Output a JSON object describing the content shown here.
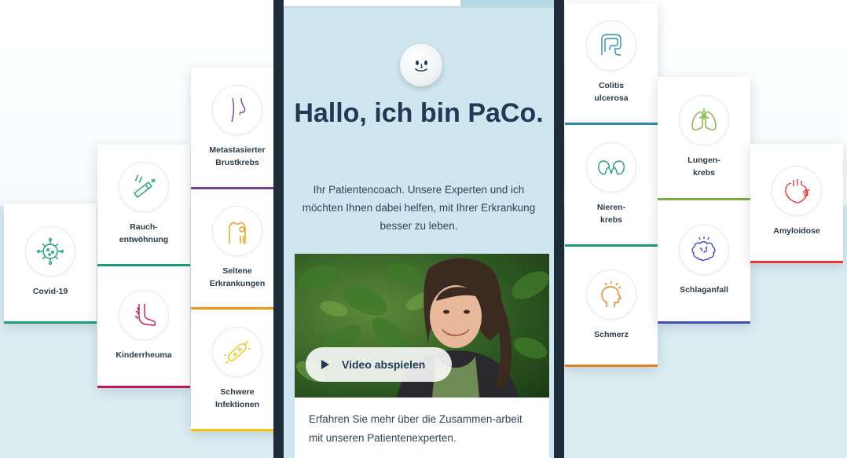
{
  "assistant": {
    "greeting": "Hallo, ich bin PaCo.",
    "intro": "Ihr Patientencoach. Unsere Experten und ich möchten Ihnen dabei helfen, mit Ihrer Erkrankung besser zu leben.",
    "video_button": "Video abspielen",
    "more_text": "Erfahren Sie mehr über die Zusammen-arbeit mit unseren Patientenexperten."
  },
  "cards": [
    {
      "label": "Covid-19",
      "icon": "virus-icon",
      "color": "#1f9e7a"
    },
    {
      "label": "Rauch-\nentwöhnung",
      "icon": "cigarette-icon",
      "color": "#1f9e7a"
    },
    {
      "label": "Kinderrheuma",
      "icon": "foot-icon",
      "color": "#c2185b"
    },
    {
      "label": "Metastasierter\nBrustkrebs",
      "icon": "breast-icon",
      "color": "#7b3fa0"
    },
    {
      "label": "Seltene\nErkrankungen",
      "icon": "body-icon",
      "color": "#f39c12"
    },
    {
      "label": "Schwere\nInfektionen",
      "icon": "bacteria-icon",
      "color": "#f1c40f"
    },
    {
      "label": "Colitis\nulcerosa",
      "icon": "intestine-icon",
      "color": "#2f8fb5"
    },
    {
      "label": "Nieren-\nkrebs",
      "icon": "kidney-icon",
      "color": "#1f9e7a"
    },
    {
      "label": "Schmerz",
      "icon": "head-pain-icon",
      "color": "#e67e22"
    },
    {
      "label": "Lungen-\nkrebs",
      "icon": "lungs-icon",
      "color": "#7cb342"
    },
    {
      "label": "Schlaganfall",
      "icon": "brain-icon",
      "color": "#3f51b5"
    },
    {
      "label": "Amyloidose",
      "icon": "heart-icon",
      "color": "#e53935"
    }
  ]
}
